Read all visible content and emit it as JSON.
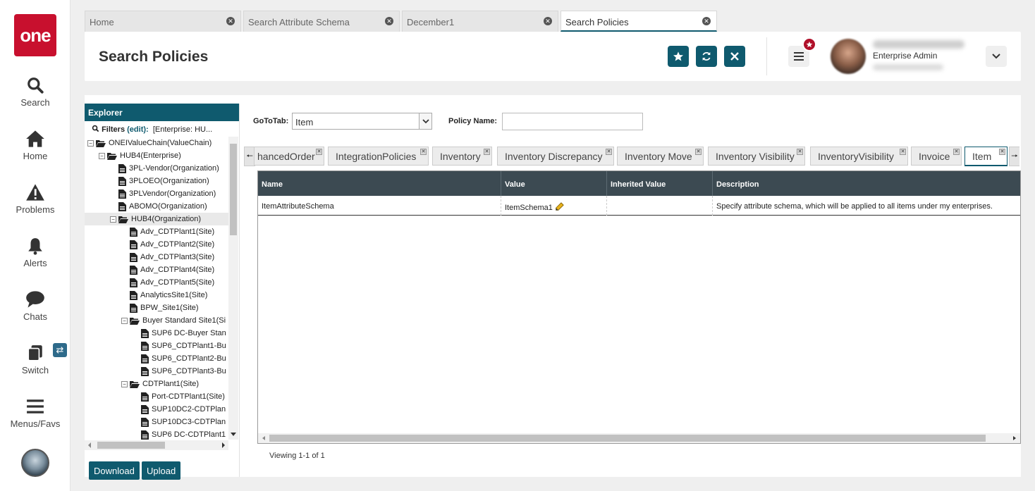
{
  "leftnav": {
    "logo_text": "one",
    "items": [
      {
        "label": "Search",
        "icon": "search-icon"
      },
      {
        "label": "Home",
        "icon": "home-icon"
      },
      {
        "label": "Problems",
        "icon": "warning-icon"
      },
      {
        "label": "Alerts",
        "icon": "bell-icon"
      },
      {
        "label": "Chats",
        "icon": "chat-icon"
      },
      {
        "label": "Switch",
        "icon": "switch-icon"
      },
      {
        "label": "Menus/Favs",
        "icon": "hamburger-icon"
      }
    ]
  },
  "tabs": [
    {
      "label": "Home"
    },
    {
      "label": "Search Attribute Schema"
    },
    {
      "label": "December1"
    },
    {
      "label": "Search Policies"
    }
  ],
  "header": {
    "title": "Search Policies",
    "user_role": "Enterprise Admin",
    "accent_color": "#0f5a6e",
    "notification_color": "#b0102a"
  },
  "explorer": {
    "title": "Explorer",
    "filters_label": "Filters",
    "filters_edit": "(edit):",
    "filters_value": "[Enterprise: HU...",
    "tree": [
      {
        "label": "ONEIValueChain(ValueChain)",
        "type": "folder",
        "expanded": true
      },
      {
        "label": "HUB4(Enterprise)",
        "type": "folder",
        "expanded": true
      },
      {
        "label": "3PL-Vendor(Organization)",
        "type": "file"
      },
      {
        "label": "3PLOEO(Organization)",
        "type": "file"
      },
      {
        "label": "3PLVendor(Organization)",
        "type": "file"
      },
      {
        "label": "ABOMO(Organization)",
        "type": "file"
      },
      {
        "label": "HUB4(Organization)",
        "type": "folder",
        "expanded": true,
        "selected": true
      },
      {
        "label": "Adv_CDTPlant1(Site)",
        "type": "file"
      },
      {
        "label": "Adv_CDTPlant2(Site)",
        "type": "file"
      },
      {
        "label": "Adv_CDTPlant3(Site)",
        "type": "file"
      },
      {
        "label": "Adv_CDTPlant4(Site)",
        "type": "file"
      },
      {
        "label": "Adv_CDTPlant5(Site)",
        "type": "file"
      },
      {
        "label": "AnalyticsSite1(Site)",
        "type": "file"
      },
      {
        "label": "BPW_Site1(Site)",
        "type": "file"
      },
      {
        "label": "Buyer Standard Site1(Si",
        "type": "folder",
        "expanded": true
      },
      {
        "label": "SUP6 DC-Buyer Stan",
        "type": "file"
      },
      {
        "label": "SUP6_CDTPlant1-Bu",
        "type": "file"
      },
      {
        "label": "SUP6_CDTPlant2-Bu",
        "type": "file"
      },
      {
        "label": "SUP6_CDTPlant3-Bu",
        "type": "file"
      },
      {
        "label": "CDTPlant1(Site)",
        "type": "folder",
        "expanded": true
      },
      {
        "label": "Port-CDTPlant1(Site)",
        "type": "file"
      },
      {
        "label": "SUP10DC2-CDTPlan",
        "type": "file"
      },
      {
        "label": "SUP10DC3-CDTPlan",
        "type": "file"
      },
      {
        "label": "SUP6 DC-CDTPlant1",
        "type": "file"
      }
    ],
    "download_label": "Download",
    "upload_label": "Upload"
  },
  "form": {
    "goto_label": "GoToTab:",
    "goto_value": "Item",
    "policy_name_label": "Policy Name:",
    "policy_name_value": ""
  },
  "policy_tabs": [
    {
      "label": "hancedOrder"
    },
    {
      "label": "IntegrationPolicies"
    },
    {
      "label": "Inventory"
    },
    {
      "label": "Inventory Discrepancy"
    },
    {
      "label": "Inventory Move"
    },
    {
      "label": "Inventory Visibility"
    },
    {
      "label": "InventoryVisibility"
    },
    {
      "label": "Invoice"
    },
    {
      "label": "Item"
    }
  ],
  "grid": {
    "columns": [
      "Name",
      "Value",
      "Inherited Value",
      "Description"
    ],
    "rows": [
      {
        "name": "ItemAttributeSchema",
        "value": "ItemSchema1",
        "inherited": "",
        "description": "Specify attribute schema, which will be applied to all items under my enterprises."
      }
    ]
  },
  "footer": {
    "viewing": "Viewing 1-1 of 1"
  }
}
